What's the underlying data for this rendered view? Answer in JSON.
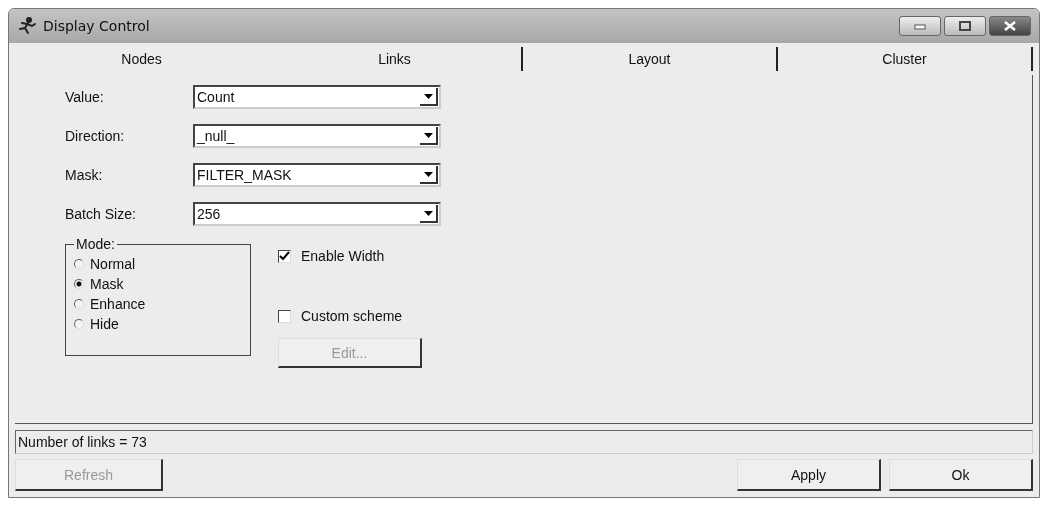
{
  "window": {
    "title": "Display Control"
  },
  "tabs": [
    {
      "label": "Nodes"
    },
    {
      "label": "Links"
    },
    {
      "label": "Layout"
    },
    {
      "label": "Cluster"
    }
  ],
  "fields": [
    {
      "label": "Value:",
      "value": "Count"
    },
    {
      "label": "Direction:",
      "value": "_null_"
    },
    {
      "label": "Mask:",
      "value": "FILTER_MASK"
    },
    {
      "label": "Batch Size:",
      "value": "256"
    }
  ],
  "mode": {
    "title": "Mode:",
    "options": [
      {
        "label": "Normal",
        "selected": false
      },
      {
        "label": "Mask",
        "selected": true
      },
      {
        "label": "Enhance",
        "selected": false
      },
      {
        "label": "Hide",
        "selected": false
      }
    ]
  },
  "checkboxes": [
    {
      "label": "Enable Width",
      "checked": true
    },
    {
      "label": "Custom scheme",
      "checked": false
    }
  ],
  "edit_button": {
    "label": "Edit...",
    "disabled": true
  },
  "status_bar": "Number of links = 73",
  "buttons": [
    {
      "label": "Refresh",
      "disabled": true
    },
    {
      "label": "Apply",
      "disabled": false
    },
    {
      "label": "Ok",
      "disabled": false
    }
  ]
}
